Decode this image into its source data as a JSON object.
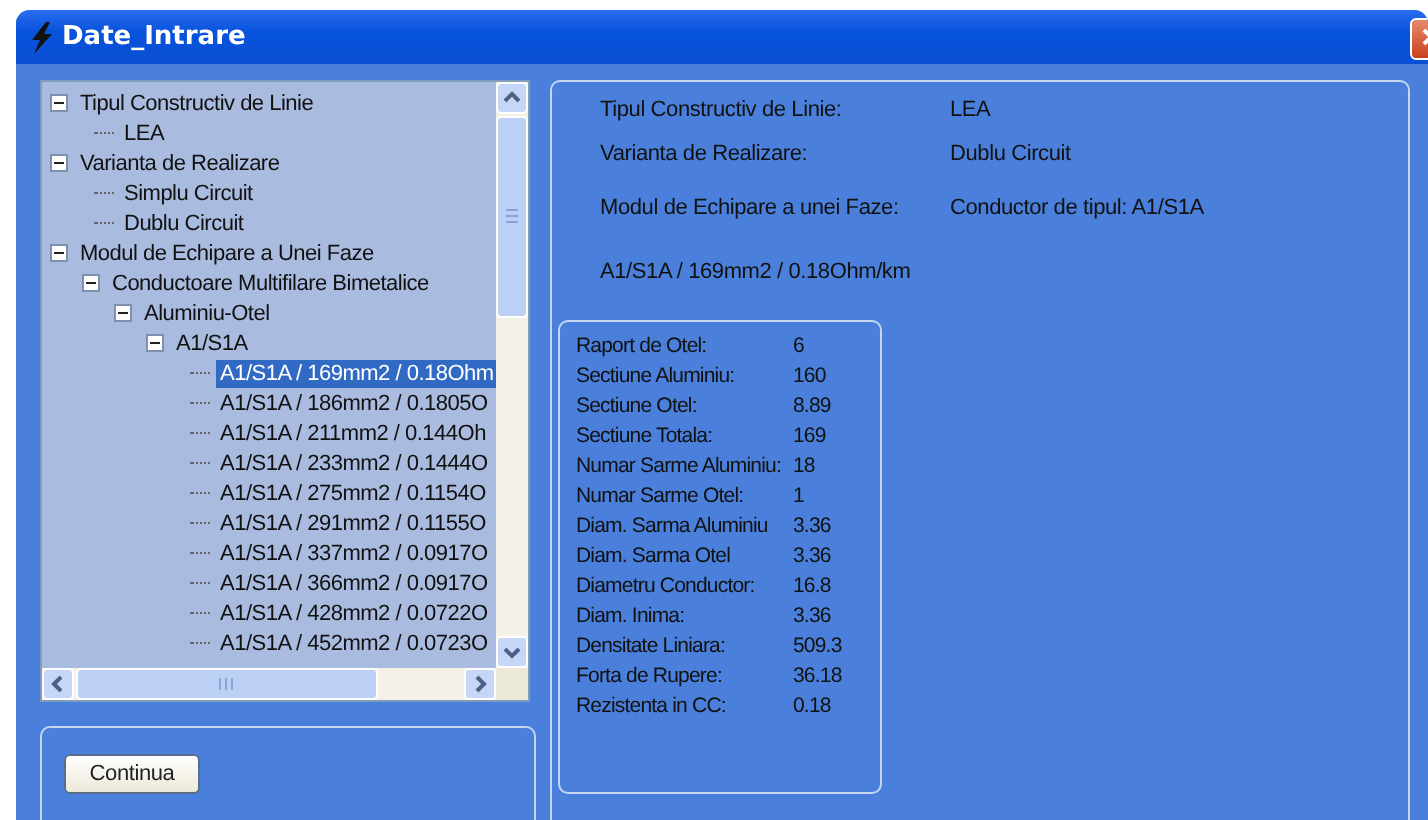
{
  "window": {
    "title": "Date_Intrare"
  },
  "tree": [
    {
      "label": "Tipul Constructiv de Linie",
      "expanded": true,
      "selected": false,
      "children": [
        {
          "label": "LEA",
          "selected": false
        }
      ]
    },
    {
      "label": "Varianta de Realizare",
      "expanded": true,
      "selected": false,
      "children": [
        {
          "label": "Simplu Circuit",
          "selected": false
        },
        {
          "label": "Dublu Circuit",
          "selected": false
        }
      ]
    },
    {
      "label": "Modul de Echipare a Unei Faze",
      "expanded": true,
      "selected": false,
      "children": [
        {
          "label": "Conductoare Multifilare Bimetalice",
          "expanded": true,
          "selected": false,
          "children": [
            {
              "label": "Aluminiu-Otel",
              "expanded": true,
              "selected": false,
              "children": [
                {
                  "label": "A1/S1A",
                  "expanded": true,
                  "selected": false,
                  "children": [
                    {
                      "label": "A1/S1A / 169mm2 / 0.18Ohm",
                      "selected": true
                    },
                    {
                      "label": "A1/S1A / 186mm2 / 0.1805O",
                      "selected": false
                    },
                    {
                      "label": "A1/S1A / 211mm2 / 0.144Oh",
                      "selected": false
                    },
                    {
                      "label": "A1/S1A / 233mm2 / 0.1444O",
                      "selected": false
                    },
                    {
                      "label": "A1/S1A / 275mm2 / 0.1154O",
                      "selected": false
                    },
                    {
                      "label": "A1/S1A / 291mm2 / 0.1155O",
                      "selected": false
                    },
                    {
                      "label": "A1/S1A / 337mm2 / 0.0917O",
                      "selected": false
                    },
                    {
                      "label": "A1/S1A / 366mm2 / 0.0917O",
                      "selected": false
                    },
                    {
                      "label": "A1/S1A / 428mm2 / 0.0722O",
                      "selected": false
                    },
                    {
                      "label": "A1/S1A / 452mm2 / 0.0723O",
                      "selected": false
                    }
                  ]
                }
              ]
            }
          ]
        }
      ]
    }
  ],
  "continue_button": "Continua",
  "summary": [
    {
      "label": "Tipul Constructiv de Linie:",
      "value": "LEA"
    },
    {
      "label": "Varianta de Realizare:",
      "value": "Dublu Circuit"
    },
    {
      "label": "Modul de Echipare a unei Faze:",
      "value": "Conductor de tipul: A1/S1A"
    }
  ],
  "selected_conductor": "A1/S1A / 169mm2 / 0.18Ohm/km",
  "properties": [
    {
      "label": "Raport de Otel:",
      "value": "6"
    },
    {
      "label": "Sectiune Aluminiu:",
      "value": "160"
    },
    {
      "label": "Sectiune Otel:",
      "value": "8.89"
    },
    {
      "label": "Sectiune Totala:",
      "value": "169"
    },
    {
      "label": "Numar Sarme Aluminiu:",
      "value": "18"
    },
    {
      "label": "Numar Sarme Otel:",
      "value": "1"
    },
    {
      "label": "Diam. Sarma Aluminiu",
      "value": "3.36"
    },
    {
      "label": "Diam. Sarma Otel",
      "value": "3.36"
    },
    {
      "label": "Diametru Conductor:",
      "value": "16.8"
    },
    {
      "label": "Diam. Inima:",
      "value": "3.36"
    },
    {
      "label": "Densitate Liniara:",
      "value": "509.3"
    },
    {
      "label": "Forta de Rupere:",
      "value": "36.18"
    },
    {
      "label": "Rezistenta in CC:",
      "value": "0.18"
    }
  ]
}
